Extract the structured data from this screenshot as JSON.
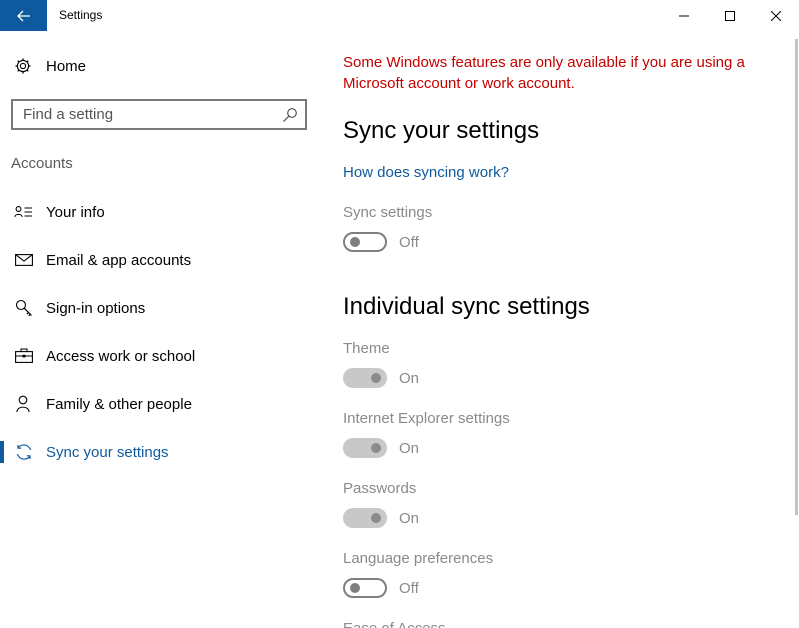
{
  "window": {
    "title": "Settings"
  },
  "nav": {
    "home_label": "Home",
    "search_placeholder": "Find a setting",
    "section_label": "Accounts",
    "items": [
      {
        "label": "Your info",
        "icon": "person-card-icon",
        "active": false
      },
      {
        "label": "Email & app accounts",
        "icon": "mail-icon",
        "active": false
      },
      {
        "label": "Sign-in options",
        "icon": "key-icon",
        "active": false
      },
      {
        "label": "Access work or school",
        "icon": "briefcase-icon",
        "active": false
      },
      {
        "label": "Family & other people",
        "icon": "person-icon",
        "active": false
      },
      {
        "label": "Sync your settings",
        "icon": "sync-icon",
        "active": true
      }
    ]
  },
  "content": {
    "warning": "Some Windows features are only available if you are using a Microsoft account or work account.",
    "title": "Sync your settings",
    "help_link": "How does syncing work?",
    "sync_settings": {
      "label": "Sync settings",
      "state": "Off"
    },
    "individual_title": "Individual sync settings",
    "individual": [
      {
        "label": "Theme",
        "state": "On"
      },
      {
        "label": "Internet Explorer settings",
        "state": "On"
      },
      {
        "label": "Passwords",
        "state": "On"
      },
      {
        "label": "Language preferences",
        "state": "Off"
      },
      {
        "label": "Ease of Access",
        "state": ""
      }
    ]
  },
  "colors": {
    "accent": "#0f5a9e",
    "warning": "#c40000",
    "disabled_text": "#8a8a8a"
  }
}
